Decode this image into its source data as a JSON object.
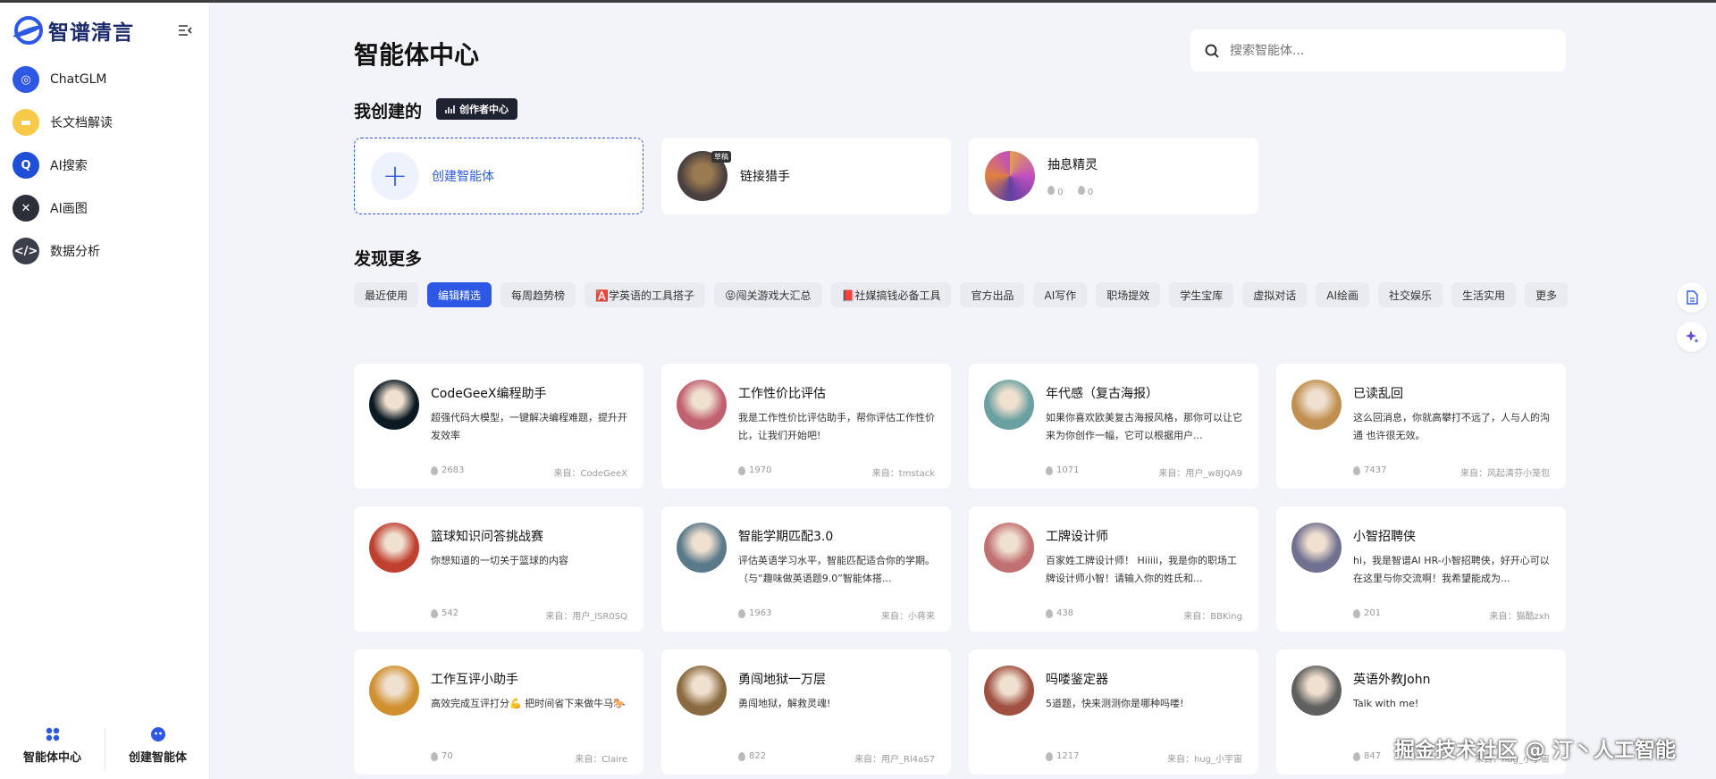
{
  "brand": {
    "logo_text": "智谱清言"
  },
  "sidebar": {
    "items": [
      {
        "label": "ChatGLM",
        "color": "#2c58e5"
      },
      {
        "label": "长文档解读",
        "color": "#f7c948"
      },
      {
        "label": "AI搜索",
        "color": "#1f4fd6"
      },
      {
        "label": "AI画图",
        "color": "#2b2f3a"
      },
      {
        "label": "数据分析",
        "color": "#3a3f4b"
      }
    ],
    "bottom": [
      {
        "label": "智能体中心"
      },
      {
        "label": "创建智能体"
      }
    ]
  },
  "page": {
    "title": "智能体中心",
    "search_placeholder": "搜索智能体..."
  },
  "my_created": {
    "title": "我创建的",
    "badge": "创作者中心",
    "create_label": "创建智能体",
    "cards": [
      {
        "name": "链接猎手",
        "badge": "草稿",
        "avatar_color": "#4a4040"
      },
      {
        "name": "抽息精灵",
        "likes": "0",
        "uses": "0",
        "avatar_color": "#c060c0"
      }
    ]
  },
  "discover": {
    "title": "发现更多",
    "tags": [
      "最近使用",
      "编辑精选",
      "每周趋势榜",
      "🅰️学英语的工具搭子",
      "😝闯关游戏大汇总",
      "📕社媒搞钱必备工具",
      "官方出品",
      "AI写作",
      "职场提效",
      "学生宝库",
      "虚拟对话",
      "AI绘画",
      "社交娱乐",
      "生活实用",
      "更多"
    ],
    "active_tag": "编辑精选"
  },
  "agents": [
    {
      "name": "CodeGeeX编程助手",
      "desc": "超强代码大模型，一键解决编程难题，提升开发效率",
      "likes": "2683",
      "source": "来自：CodeGeeX",
      "color": "#0b1a22"
    },
    {
      "name": "工作性价比评估",
      "desc": "我是工作性价比评估助手，帮你评估工作性价比，让我们开始吧!",
      "likes": "1970",
      "source": "来自：tmstack",
      "color": "#c06070"
    },
    {
      "name": "年代感（复古海报）",
      "desc": "如果你喜欢欧美复古海报风格，那你可以让它来为你创作一幅，它可以根据用户...",
      "likes": "1071",
      "source": "来自：用户_w8JQA9",
      "color": "#6aa0a0"
    },
    {
      "name": "已读乱回",
      "desc": "这么回消息，你就高攀打不远了，人与人的沟通 也许很无效。",
      "likes": "7437",
      "source": "来自：风起清芬小笼包",
      "color": "#c09050"
    },
    {
      "name": "篮球知识问答挑战赛",
      "desc": "你想知道的一切关于篮球的内容",
      "likes": "542",
      "source": "来自：用户_lSR0SQ",
      "color": "#c04030"
    },
    {
      "name": "智能学期匹配3.0",
      "desc": "评估英语学习水平，智能匹配适合你的学期。（与“趣味做英语题9.0”智能体搭...",
      "likes": "1963",
      "source": "来自：小蒋来",
      "color": "#5a7a8a"
    },
    {
      "name": "工牌设计师",
      "desc": "百家姓工牌设计师！ Hiiiii，我是你的职场工牌设计师小智！请输入你的姓氏和...",
      "likes": "438",
      "source": "来自：BBKing",
      "color": "#c07070"
    },
    {
      "name": "小智招聘侠",
      "desc": "hi，我是智谱AI HR-小智招聘侠，好开心可以在这里与你交流啊！我希望能成为...",
      "likes": "201",
      "source": "来自：猫酷zxh",
      "color": "#707090"
    },
    {
      "name": "工作互评小助手",
      "desc": "高效完成互评打分💪 把时间省下来做牛马🐎",
      "likes": "70",
      "source": "来自：Claire",
      "color": "#d09030"
    },
    {
      "name": "勇闯地狱一万层",
      "desc": "勇闯地狱，解救灵魂!",
      "likes": "822",
      "source": "来自：用户_Rl4aS7",
      "color": "#8a6a40"
    },
    {
      "name": "吗喽鉴定器",
      "desc": "5道题，快来测测你是哪种吗喽!",
      "likes": "1217",
      "source": "来自：hug_小宇宙",
      "color": "#a05040"
    },
    {
      "name": "英语外教John",
      "desc": "Talk with me!",
      "likes": "847",
      "source": "来自：hug_小宇宙",
      "color": "#606060"
    }
  ],
  "watermark": "掘金技术社区 @ 汀丶人工智能"
}
